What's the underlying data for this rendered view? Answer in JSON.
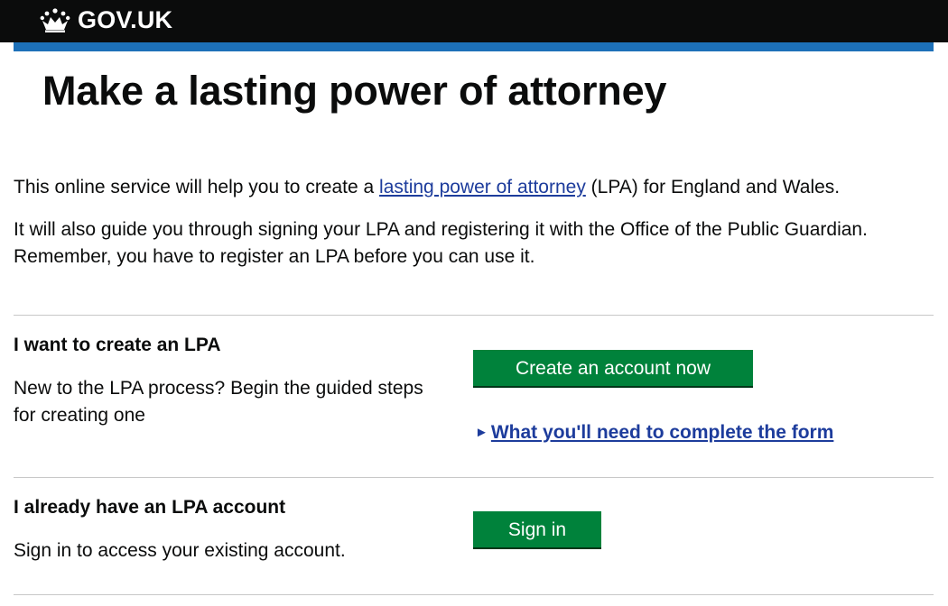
{
  "header": {
    "logo_text": "GOV.UK",
    "logo_icon": "crown-icon",
    "background": "#0b0c0c",
    "accent_bar": "#1d70b8"
  },
  "page": {
    "title": "Make a lasting power of attorney",
    "intro_before_link": "This online service will help you to create a ",
    "intro_link": "lasting power of attorney",
    "intro_after_link": " (LPA) for England and Wales.",
    "intro_second": "It will also guide you through signing your LPA and registering it with the Office of the Public Guardian. Remember, you have to register an LPA before you can use it."
  },
  "create_section": {
    "heading": "I want to create an LPA",
    "text": "New to the LPA process? Begin the guided steps for creating one",
    "button_label": "Create an account now",
    "details_arrow": "►",
    "details_label": "What you'll need to complete the form"
  },
  "signin_section": {
    "heading": "I already have an LPA account",
    "text": "Sign in to access your existing account.",
    "button_label": "Sign in"
  },
  "colors": {
    "button": "#00823b",
    "link": "#1d3c9c"
  }
}
